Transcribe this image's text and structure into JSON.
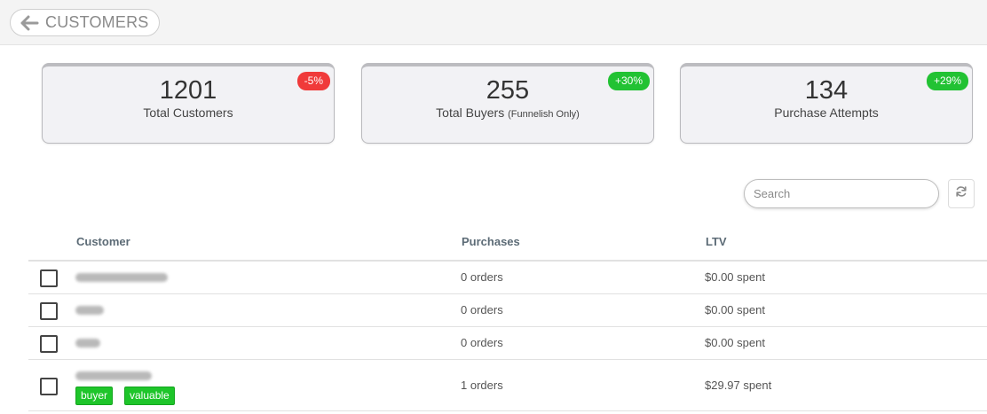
{
  "header": {
    "title": "CUSTOMERS"
  },
  "stats": [
    {
      "value": "1201",
      "label": "Total Customers",
      "note": "",
      "change": "-5%",
      "trend": "negative"
    },
    {
      "value": "255",
      "label": "Total Buyers",
      "note": "(Funnelish Only)",
      "change": "+30%",
      "trend": "positive"
    },
    {
      "value": "134",
      "label": "Purchase Attempts",
      "note": "",
      "change": "+29%",
      "trend": "positive"
    }
  ],
  "search": {
    "placeholder": "Search",
    "value": ""
  },
  "table": {
    "columns": [
      "Customer",
      "Purchases",
      "LTV"
    ],
    "rows": [
      {
        "purchases": "0 orders",
        "ltv": "$0.00 spent",
        "tags": []
      },
      {
        "purchases": "0 orders",
        "ltv": "$0.00 spent",
        "tags": []
      },
      {
        "purchases": "0 orders",
        "ltv": "$0.00 spent",
        "tags": []
      },
      {
        "purchases": "1 orders",
        "ltv": "$29.97 spent",
        "tags": [
          "buyer",
          "valuable"
        ]
      }
    ]
  },
  "icons": {
    "back": "arrow-left-icon",
    "refresh": "refresh-icon"
  },
  "colors": {
    "negative": "#f03a3a",
    "positive": "#22c233",
    "tag": "#1ec52a"
  }
}
